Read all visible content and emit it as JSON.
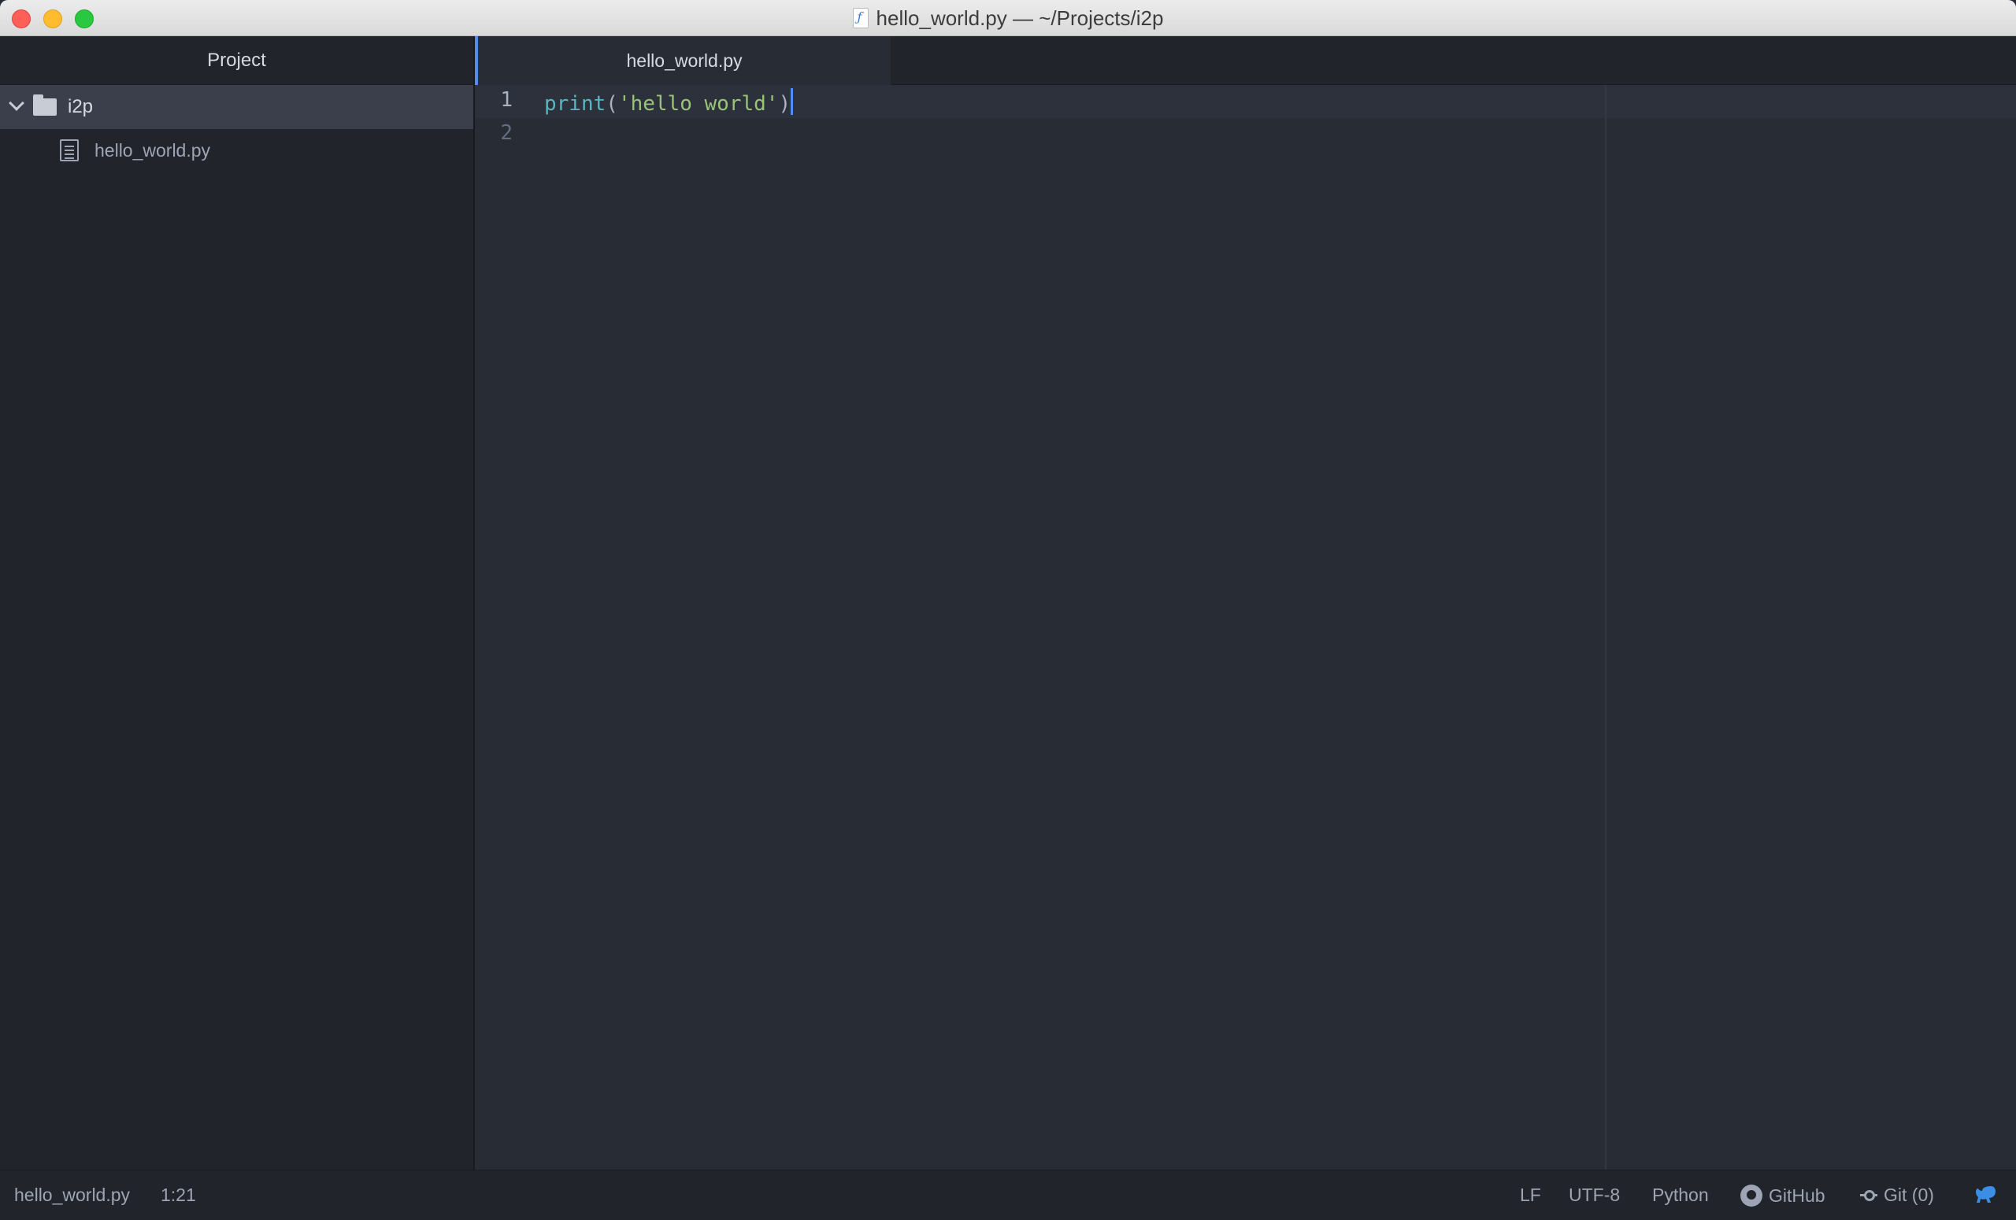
{
  "window": {
    "title": "hello_world.py — ~/Projects/i2p"
  },
  "sidebar": {
    "header": "Project",
    "root_folder": "i2p",
    "files": [
      "hello_world.py"
    ]
  },
  "tabs": [
    {
      "label": "hello_world.py",
      "active": true
    }
  ],
  "editor": {
    "line_numbers": [
      "1",
      "2"
    ],
    "code": {
      "fn": "print",
      "open_paren": "(",
      "string": "'hello world'",
      "close_paren": ")"
    }
  },
  "statusbar": {
    "file_name": "hello_world.py",
    "cursor_position": "1:21",
    "line_ending": "LF",
    "encoding": "UTF-8",
    "grammar": "Python",
    "github": "GitHub",
    "git": "Git (0)"
  },
  "icons": {
    "title_file": "python-file-icon",
    "folder": "folder-icon",
    "file": "file-text-icon",
    "github": "github-icon",
    "git": "git-commit-icon",
    "updates": "squirrel-icon"
  },
  "colors": {
    "accent": "#568af2",
    "editor_bg": "#282c34",
    "sidebar_bg": "#21252b",
    "function": "#56b6c2",
    "string": "#98c379"
  }
}
